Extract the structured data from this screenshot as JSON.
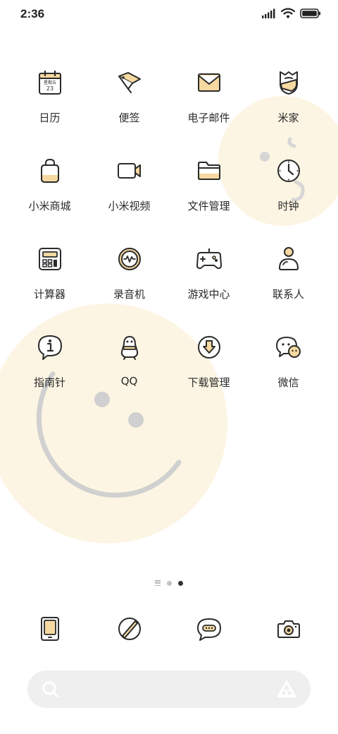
{
  "status_bar": {
    "time": "2:36",
    "icons": [
      "signal-icon",
      "wifi-icon",
      "battery-icon"
    ]
  },
  "apps": [
    {
      "label": "日历",
      "icon": "calendar-icon",
      "calendar_weekday": "星期五",
      "calendar_day": "23"
    },
    {
      "label": "便签",
      "icon": "notes-icon"
    },
    {
      "label": "电子邮件",
      "icon": "mail-icon"
    },
    {
      "label": "米家",
      "icon": "mijia-icon"
    },
    {
      "label": "小米商城",
      "icon": "shopping-bag-icon"
    },
    {
      "label": "小米视频",
      "icon": "video-camera-icon"
    },
    {
      "label": "文件管理",
      "icon": "folder-icon"
    },
    {
      "label": "时钟",
      "icon": "clock-icon"
    },
    {
      "label": "计算器",
      "icon": "calculator-icon"
    },
    {
      "label": "录音机",
      "icon": "recorder-icon"
    },
    {
      "label": "游戏中心",
      "icon": "gamepad-icon"
    },
    {
      "label": "联系人",
      "icon": "contacts-icon"
    },
    {
      "label": "指南针",
      "icon": "compass-icon"
    },
    {
      "label": "QQ",
      "icon": "qq-penguin-icon"
    },
    {
      "label": "下载管理",
      "icon": "download-icon"
    },
    {
      "label": "微信",
      "icon": "wechat-icon"
    }
  ],
  "page_indicator": {
    "pages": 2,
    "active_page": 2,
    "has_feed_page": true
  },
  "dock": [
    {
      "icon": "phone-icon"
    },
    {
      "icon": "browser-icon"
    },
    {
      "icon": "messages-icon"
    },
    {
      "icon": "camera-icon"
    }
  ],
  "search": {
    "icon": "search-icon",
    "assistant_icon": "assistant-icon"
  },
  "colors": {
    "accent": "#f5d9a0",
    "wallpaper_blob": "#fdf5e3",
    "line": "#2b2b2b",
    "smile": "#d0d0d0"
  }
}
